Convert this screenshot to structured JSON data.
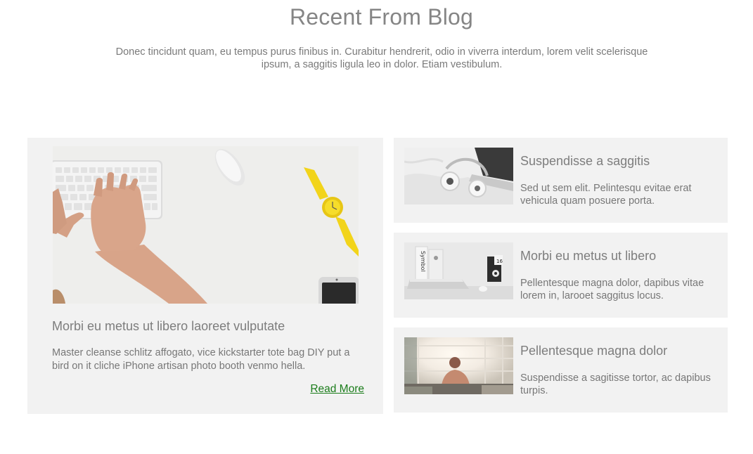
{
  "section": {
    "title": "Recent From Blog",
    "description": "Donec tincidunt quam, eu tempus purus finibus in. Curabitur hendrerit, odio in viverra interdum, lorem velit scelerisque ipsum, a saggitis ligula leo in dolor. Etiam vestibulum."
  },
  "featured_post": {
    "image": "desk-keyboard-mouse-watch-phone-photo",
    "title": "Morbi eu metus ut libero laoreet vulputate",
    "excerpt": "Master cleanse schlitz affogato, vice kickstarter tote bag DIY put a bird on it cliche iPhone artisan photo booth venmo hella.",
    "read_more": "Read More",
    "link_color": "#1b7d1b"
  },
  "posts": [
    {
      "image": "headphones-laptop-photo",
      "title": "Suspendisse a saggitis",
      "excerpt": "Sed ut sem elit. Pelintesqu evitae erat vehicula quam posuere porta."
    },
    {
      "image": "laptop-books-desk-photo",
      "book_label": "Symbol",
      "calendar_number": "16",
      "title": "Morbi eu metus ut libero",
      "excerpt": "Pellentesque magna dolor, dapibus vitae lorem in, larooet saggitus locus."
    },
    {
      "image": "bright-office-window-photo",
      "title": "Pellentesque magna dolor",
      "excerpt": "Suspendisse a sagitisse tortor, ac dapibus turpis."
    }
  ],
  "colors": {
    "card_background": "#f2f2f2",
    "text": "#777777",
    "title": "#858585"
  }
}
